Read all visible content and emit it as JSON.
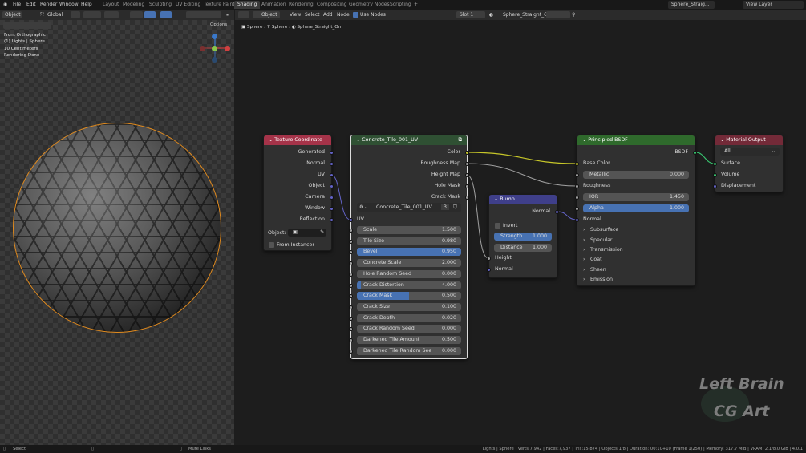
{
  "topbar": {
    "menus": [
      "File",
      "Edit",
      "Render",
      "Window",
      "Help"
    ],
    "workspaces": [
      "Layout",
      "Modeling",
      "Sculpting",
      "UV Editing",
      "Texture Paint",
      "Shading",
      "Animation",
      "Rendering",
      "Compositing",
      "Geometry Nodes",
      "Scripting"
    ],
    "active_workspace": "Shading",
    "scene_name": "Sphere_Straig...",
    "view_layer": "View Layer"
  },
  "viewport_header": {
    "mode": "Object",
    "orientation": "Global",
    "options": "Options"
  },
  "viewport_overlay": {
    "line1": "Front Orthographic",
    "line2": "(1) Lights | Sphere",
    "line3": "10 Centimeters",
    "line4": "Rendering Done"
  },
  "gizmo": {
    "x": "X",
    "y": "Y",
    "z": "Z"
  },
  "node_header": {
    "editor_type": "Object",
    "menus": [
      "View",
      "Select",
      "Add",
      "Node"
    ],
    "use_nodes_label": "Use Nodes",
    "slot": "Slot 1",
    "material": "Sphere_Straight_On"
  },
  "breadcrumb": [
    "Sphere",
    "Sphere",
    "Sphere_Straight_On"
  ],
  "nodes": {
    "texcoord": {
      "title": "Texture Coordinate",
      "outputs": [
        "Generated",
        "Normal",
        "UV",
        "Object",
        "Camera",
        "Window",
        "Reflection"
      ],
      "object_label": "Object:",
      "from_instancer": "From Instancer"
    },
    "group": {
      "title": "Concrete_Tile_001_UV",
      "outputs": [
        "Color",
        "Roughness Map",
        "Height Map",
        "Hole Mask",
        "Crack Mask"
      ],
      "datablock": "Concrete_Tile_001_UV",
      "users": "3",
      "uv_label": "UV",
      "inputs": [
        {
          "label": "Scale",
          "value": "1.500",
          "fill": 0
        },
        {
          "label": "Tile Size",
          "value": "0.980",
          "fill": 0
        },
        {
          "label": "Bevel",
          "value": "0.950",
          "fill": 1.0
        },
        {
          "label": "Concrete Scale",
          "value": "2.000",
          "fill": 0
        },
        {
          "label": "Hole Random Seed",
          "value": "0.000",
          "fill": 0
        },
        {
          "label": "Crack Distortion",
          "value": "4.000",
          "fill": 0.04
        },
        {
          "label": "Crack Mask",
          "value": "0.500",
          "fill": 0.5
        },
        {
          "label": "Crack Size",
          "value": "0.100",
          "fill": 0
        },
        {
          "label": "Crack Depth",
          "value": "0.020",
          "fill": 0
        },
        {
          "label": "Crack Random Seed",
          "value": "0.000",
          "fill": 0
        },
        {
          "label": "Darkened Tile Amount",
          "value": "0.500",
          "fill": 0
        },
        {
          "label": "Darkened Tile Random See",
          "value": "0.000",
          "fill": 0
        }
      ]
    },
    "bump": {
      "title": "Bump",
      "output": "Normal",
      "invert": "Invert",
      "strength_label": "Strength",
      "strength": "1.000",
      "distance_label": "Distance",
      "distance": "1.000",
      "height": "Height",
      "normal_in": "Normal"
    },
    "bsdf": {
      "title": "Principled BSDF",
      "output": "BSDF",
      "base_color": "Base Color",
      "metallic_label": "Metallic",
      "metallic": "0.000",
      "roughness": "Roughness",
      "ior_label": "IOR",
      "ior": "1.450",
      "alpha_label": "Alpha",
      "alpha": "1.000",
      "normal": "Normal",
      "panels": [
        "Subsurface",
        "Specular",
        "Transmission",
        "Coat",
        "Sheen",
        "Emission"
      ]
    },
    "output": {
      "title": "Material Output",
      "target": "All",
      "inputs": [
        "Surface",
        "Volume",
        "Displacement"
      ]
    }
  },
  "statusbar": {
    "left1": "Select",
    "left2": "Mute Links",
    "right": "Lights | Sphere | Verts:7,942 | Faces:7,937 | Tris:15,874 | Objects:1/8 | Duration: 00:10+10 (Frame 1/250) | Memory: 317.7 MiB | VRAM: 2.1/8.0 GiB | 4.0.1"
  },
  "watermark": {
    "line1": "Left Brain",
    "line2": "CG Art"
  },
  "colors": {
    "texcoord_header": "#a53349",
    "group_header": "#2f5033",
    "bump_header": "#3f3f8a",
    "bsdf_header": "#2f6a2c",
    "output_header": "#732a38",
    "accent": "#4772b3",
    "selection": "#e08a1e"
  }
}
